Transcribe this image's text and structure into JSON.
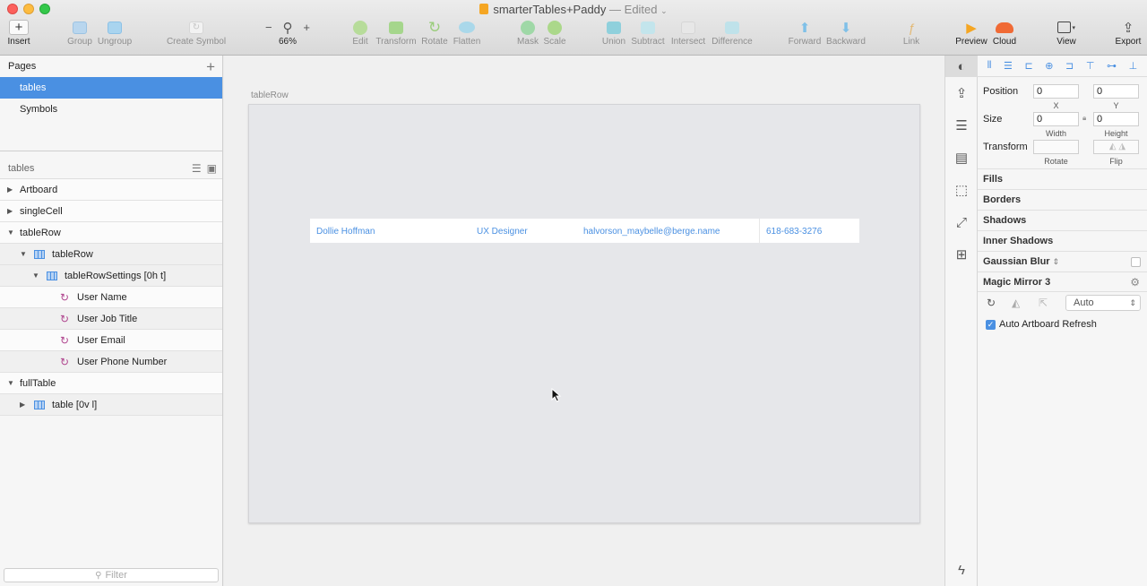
{
  "window": {
    "title": "smarterTables+Paddy",
    "status": "— Edited"
  },
  "toolbar": {
    "insert": "Insert",
    "group": "Group",
    "ungroup": "Ungroup",
    "create_symbol": "Create Symbol",
    "zoom": "66%",
    "edit": "Edit",
    "transform": "Transform",
    "rotate": "Rotate",
    "flatten": "Flatten",
    "mask": "Mask",
    "scale": "Scale",
    "union": "Union",
    "subtract": "Subtract",
    "intersect": "Intersect",
    "difference": "Difference",
    "forward": "Forward",
    "backward": "Backward",
    "link": "Link",
    "preview": "Preview",
    "cloud": "Cloud",
    "view": "View",
    "export": "Export"
  },
  "sidebar": {
    "pages_title": "Pages",
    "pages": [
      "tables",
      "Symbols"
    ],
    "layers_title": "tables",
    "layers": {
      "artboard": "Artboard",
      "single_cell": "singleCell",
      "table_row": "tableRow",
      "table_row_group": "tableRow",
      "table_row_settings": "tableRowSettings [0h t]",
      "user_name": "User Name",
      "user_job_title": "User Job Title",
      "user_email": "User Email",
      "user_phone": "User Phone Number",
      "full_table": "fullTable",
      "table": "table [0v l]"
    },
    "filter_placeholder": "Filter"
  },
  "canvas": {
    "artboard_label": "tableRow",
    "row": {
      "name": "Dollie Hoffman",
      "job": "UX Designer",
      "email": "halvorson_maybelle@berge.name",
      "phone": "618-683-3276"
    }
  },
  "inspector": {
    "position_label": "Position",
    "pos_x": "0",
    "pos_y": "0",
    "x_label": "X",
    "y_label": "Y",
    "size_label": "Size",
    "width": "0",
    "height": "0",
    "width_label": "Width",
    "height_label": "Height",
    "transform_label": "Transform",
    "rotate_label": "Rotate",
    "flip_label": "Flip",
    "fills": "Fills",
    "borders": "Borders",
    "shadows": "Shadows",
    "inner_shadows": "Inner Shadows",
    "gaussian_blur": "Gaussian Blur",
    "magic_mirror": "Magic Mirror 3",
    "mm_mode": "Auto",
    "auto_refresh": "Auto Artboard Refresh"
  },
  "colors": {
    "accent": "#4a90e2",
    "canvas": "#f0f0f0",
    "artboard": "#e6e7ea"
  }
}
